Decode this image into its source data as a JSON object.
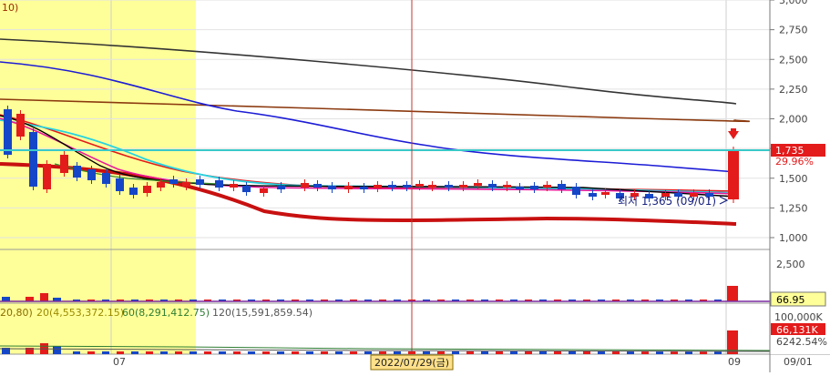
{
  "price_axis": {
    "ticks": [
      {
        "label": "3,000",
        "value": 3000
      },
      {
        "label": "2,750",
        "value": 2750
      },
      {
        "label": "2,500",
        "value": 2500
      },
      {
        "label": "2,250",
        "value": 2250
      },
      {
        "label": "2,000",
        "value": 2000
      },
      {
        "label": "1,750",
        "value": 1750
      },
      {
        "label": "1,500",
        "value": 1500
      },
      {
        "label": "1,250",
        "value": 1250
      },
      {
        "label": "1,000",
        "value": 1000
      }
    ],
    "current_price_label": "1,735",
    "change_label": "29.96%"
  },
  "price_chart": {
    "top_left_fragment": "10)",
    "low_annotation": "최저 1,365 (09/01)",
    "current_price_value": 1735,
    "high_marker": "down-arrow"
  },
  "volume_panel1": {
    "axis_label": "2,500",
    "value_box": "66.95"
  },
  "volume_panel2": {
    "legend": [
      {
        "text": "20,80)",
        "color": "#8a6d00"
      },
      {
        "text": "20(4,553,372.15)",
        "color": "#9a8a00"
      },
      {
        "text": "60(8,291,412.75)",
        "color": "#2e7d32"
      },
      {
        "text": "120(15,591,859.54)",
        "color": "#555555"
      }
    ],
    "axis_label": "100,000K",
    "value_box": "66,131K",
    "pct": "6242.54%"
  },
  "x_axis": {
    "labels": [
      "07",
      "09",
      "09/01"
    ],
    "crosshair_label": "2022/07/29(금)"
  },
  "colors": {
    "highlight": "#ffff99",
    "up": "#e31b1b",
    "down": "#1546c7",
    "crosshair": "#c0392b",
    "ma5": "#000000",
    "ma10": "#e8189a",
    "ma20": "#e31b1b",
    "ma60": "#1c1cd6",
    "ma120": "#8b3a0f",
    "ma240": "#333333",
    "cyan": "#27d3e0",
    "current_line": "#39c9c9",
    "thick_red": "#c81010"
  }
}
